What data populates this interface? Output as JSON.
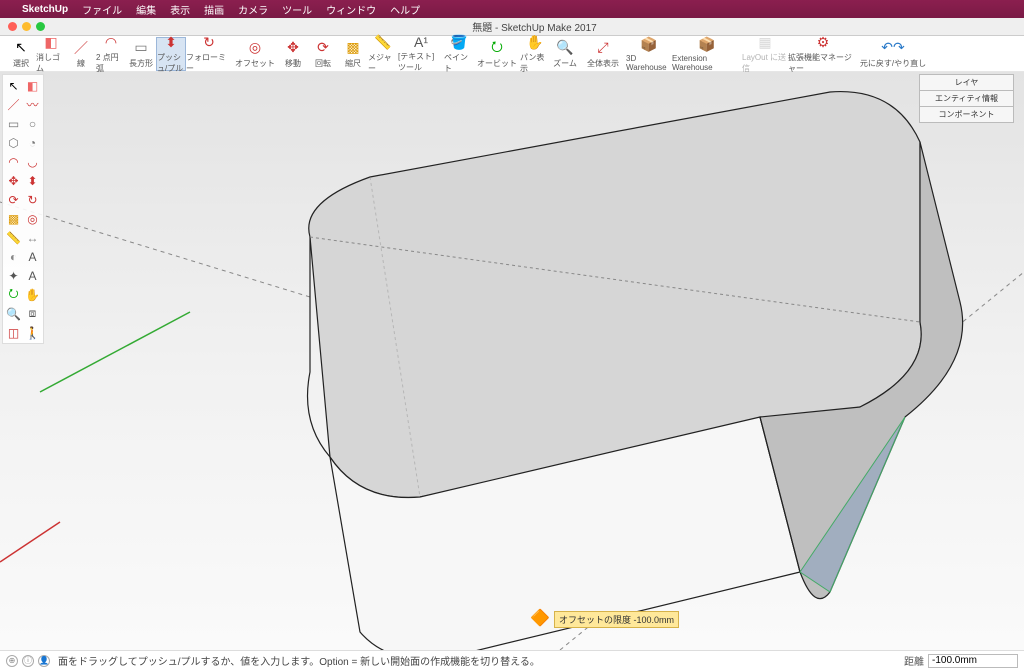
{
  "mac_menu": {
    "app": "SketchUp",
    "items": [
      "ファイル",
      "編集",
      "表示",
      "描画",
      "カメラ",
      "ツール",
      "ウィンドウ",
      "ヘルプ"
    ]
  },
  "window_title": "無題 - SketchUp Make 2017",
  "toolbar": [
    {
      "id": "select",
      "label": "選択",
      "glyph": "↖",
      "color": "#000"
    },
    {
      "id": "eraser",
      "label": "消しゴム",
      "glyph": "◧",
      "color": "#e66"
    },
    {
      "id": "line",
      "label": "線",
      "glyph": "／",
      "color": "#c33"
    },
    {
      "id": "arc",
      "label": "2 点円弧",
      "glyph": "◠",
      "color": "#c33"
    },
    {
      "id": "rect",
      "label": "長方形",
      "glyph": "▭",
      "color": "#777"
    },
    {
      "id": "pushpull",
      "label": "プッシュ/プル",
      "glyph": "⬍",
      "color": "#c33",
      "active": true
    },
    {
      "id": "followme",
      "label": "フォローミー",
      "glyph": "↻",
      "color": "#c33",
      "wide": true
    },
    {
      "id": "offset",
      "label": "オフセット",
      "glyph": "◎",
      "color": "#c33",
      "wide": true
    },
    {
      "id": "move",
      "label": "移動",
      "glyph": "✥",
      "color": "#c33"
    },
    {
      "id": "rotate",
      "label": "回転",
      "glyph": "⟳",
      "color": "#c33"
    },
    {
      "id": "scale",
      "label": "縮尺",
      "glyph": "▩",
      "color": "#d90"
    },
    {
      "id": "tape",
      "label": "メジャー",
      "glyph": "📏",
      "color": "#888"
    },
    {
      "id": "text",
      "label": "[テキスト] ツール",
      "glyph": "A¹",
      "color": "#555",
      "wide": true
    },
    {
      "id": "paint",
      "label": "ペイント",
      "glyph": "🪣",
      "color": "#c33"
    },
    {
      "id": "orbit",
      "label": "オービット",
      "glyph": "⭮",
      "color": "#0a0",
      "wide": true
    },
    {
      "id": "pan",
      "label": "パン表示",
      "glyph": "✋",
      "color": "#c80"
    },
    {
      "id": "zoom",
      "label": "ズーム",
      "glyph": "🔍",
      "color": "#555"
    },
    {
      "id": "zoomext",
      "label": "全体表示",
      "glyph": "⤢",
      "color": "#c33",
      "wide": true
    },
    {
      "id": "3dwh",
      "label": "3D Warehouse",
      "glyph": "📦",
      "color": "#c33",
      "wide": true
    },
    {
      "id": "extwh",
      "label": "Extension Warehouse",
      "glyph": "📦",
      "color": "#c33",
      "wider": true
    },
    {
      "id": "layout",
      "label": "LayOut に送信",
      "glyph": "▦",
      "color": "#aaa",
      "wide": true,
      "disabled": true
    },
    {
      "id": "extmgr",
      "label": "拡張機能マネージャー",
      "glyph": "⚙",
      "color": "#c33",
      "wider": true
    },
    {
      "id": "undo",
      "label": "元に戻す/やり直し",
      "glyph": "↶↷",
      "color": "#2a7ac9",
      "wider": true
    }
  ],
  "palette": [
    {
      "id": "select",
      "g": "↖",
      "c": "#000"
    },
    {
      "id": "eraser",
      "g": "◧",
      "c": "#e66"
    },
    {
      "id": "line",
      "g": "／",
      "c": "#c33"
    },
    {
      "id": "freehand",
      "g": "〰",
      "c": "#c33"
    },
    {
      "id": "rect",
      "g": "▭",
      "c": "#777"
    },
    {
      "id": "circle",
      "g": "○",
      "c": "#777"
    },
    {
      "id": "poly",
      "g": "⬡",
      "c": "#777"
    },
    {
      "id": "pie",
      "g": "◔",
      "c": "#777"
    },
    {
      "id": "arc",
      "g": "◠",
      "c": "#c33"
    },
    {
      "id": "arc2",
      "g": "◡",
      "c": "#c33"
    },
    {
      "id": "move",
      "g": "✥",
      "c": "#c33"
    },
    {
      "id": "pushpull",
      "g": "⬍",
      "c": "#c33"
    },
    {
      "id": "rotate",
      "g": "⟳",
      "c": "#c33"
    },
    {
      "id": "followme",
      "g": "↻",
      "c": "#c33"
    },
    {
      "id": "scale",
      "g": "▩",
      "c": "#d90"
    },
    {
      "id": "offset",
      "g": "◎",
      "c": "#c33"
    },
    {
      "id": "tape",
      "g": "📏",
      "c": "#888"
    },
    {
      "id": "dim",
      "g": "↔",
      "c": "#888"
    },
    {
      "id": "protractor",
      "g": "◐",
      "c": "#888"
    },
    {
      "id": "text",
      "g": "A",
      "c": "#555"
    },
    {
      "id": "axes",
      "g": "✦",
      "c": "#555"
    },
    {
      "id": "3dtext",
      "g": "A",
      "c": "#555"
    },
    {
      "id": "orbit",
      "g": "⭮",
      "c": "#0a0"
    },
    {
      "id": "pan",
      "g": "✋",
      "c": "#c80"
    },
    {
      "id": "zoom",
      "g": "🔍",
      "c": "#555"
    },
    {
      "id": "zoomwin",
      "g": "⧈",
      "c": "#555"
    },
    {
      "id": "section",
      "g": "◫",
      "c": "#c33"
    },
    {
      "id": "walk",
      "g": "🚶",
      "c": "#555"
    }
  ],
  "right_panels": [
    "レイヤ",
    "エンティティ情報",
    "コンポーネント"
  ],
  "tooltip": "オフセットの限度 -100.0mm",
  "status": {
    "hint": "面をドラッグしてプッシュ/プルするか、値を入力します。Option = 新しい開始面の作成機能を切り替える。",
    "field_label": "距離",
    "field_value": "-100.0mm"
  }
}
